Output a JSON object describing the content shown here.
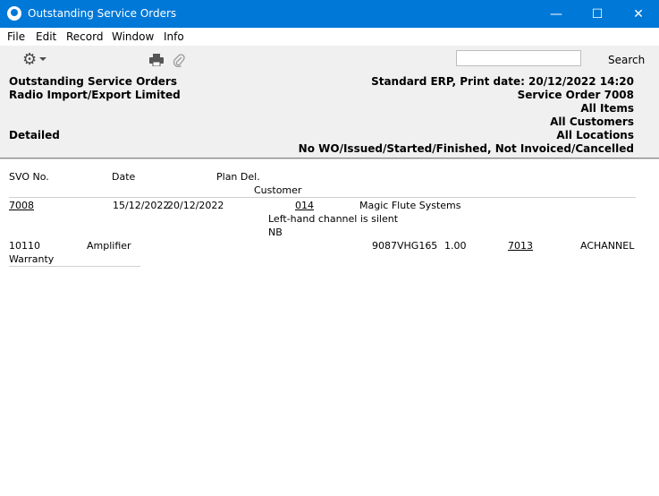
{
  "window": {
    "title": "Outstanding Service Orders",
    "min": "—",
    "max": "☐",
    "close": "✕"
  },
  "menu": {
    "file": "File",
    "edit": "Edit",
    "record": "Record",
    "window": "Window",
    "info": "Info"
  },
  "toolbar": {
    "search_label": "Search",
    "search_value": ""
  },
  "report_header": {
    "title": "Outstanding Service Orders",
    "company": "Radio Import/Export Limited",
    "mode": "Detailed",
    "print_line": "Standard ERP, Print date: 20/12/2022 14:20",
    "service_order": "Service Order 7008",
    "items": "All Items",
    "customers": "All Customers",
    "locations": "All Locations",
    "status_filter": "No WO/Issued/Started/Finished, Not Invoiced/Cancelled"
  },
  "columns": {
    "svo_no": "SVO No.",
    "date": "Date",
    "plan_del": "Plan Del.",
    "customer": "Customer"
  },
  "order": {
    "svo_no": "7008",
    "date": "15/12/2022",
    "plan_del": "20/12/2022",
    "customer_code": "014",
    "customer_name": "Magic Flute Systems",
    "comment": "Left-hand channel is silent",
    "note": "NB"
  },
  "item_row": {
    "item_code": "10110",
    "item_name": "Amplifier",
    "serial": "9087VHG165",
    "qty": "1.00",
    "ref": "7013",
    "class": "ACHANNEL",
    "type": "Warranty"
  }
}
